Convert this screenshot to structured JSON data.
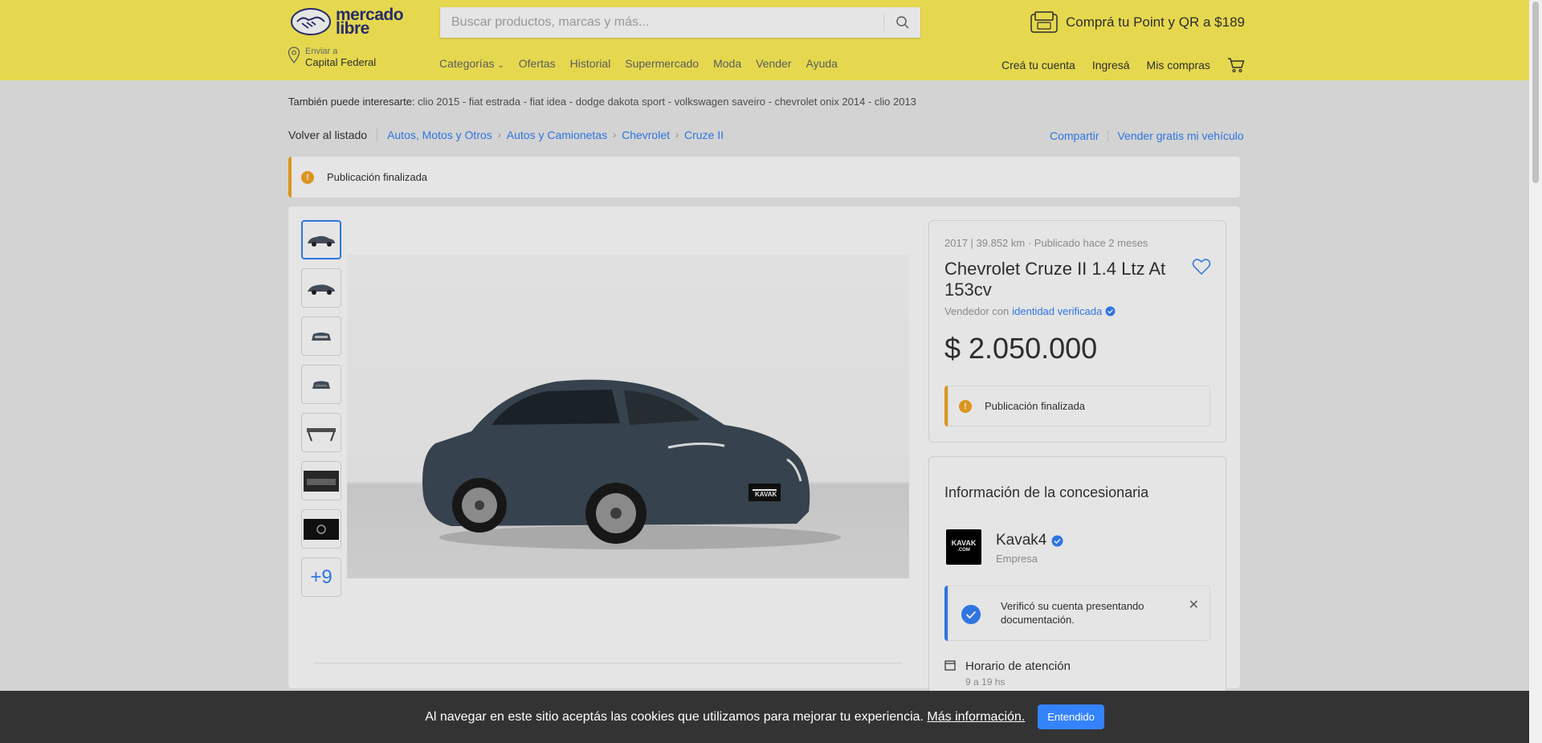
{
  "header": {
    "logo_text_line1": "mercado",
    "logo_text_line2": "libre",
    "search_placeholder": "Buscar productos, marcas y más...",
    "promo_text": "Comprá tu Point y QR a $189",
    "location_label": "Enviar a",
    "location_value": "Capital Federal",
    "nav": [
      "Categorías",
      "Ofertas",
      "Historial",
      "Supermercado",
      "Moda",
      "Vender",
      "Ayuda"
    ],
    "user_nav": [
      "Creá tu cuenta",
      "Ingresá",
      "Mis compras"
    ]
  },
  "suggestions": {
    "label": "También puede interesarte:",
    "items": "clio 2015 - fiat estrada - fiat idea - dodge dakota sport - volkswagen saveiro - chevrolet onix 2014 - clio 2013"
  },
  "breadcrumb": {
    "back": "Volver al listado",
    "items": [
      "Autos, Motos y Otros",
      "Autos y Camionetas",
      "Chevrolet",
      "Cruze II"
    ]
  },
  "actions": {
    "share": "Compartir",
    "sell": "Vender gratis mi vehículo"
  },
  "alert": {
    "text": "Publicación finalizada"
  },
  "gallery": {
    "more_count": "+9",
    "logo_text": "KAVAK"
  },
  "listing": {
    "meta": "2017 | 39.852 km · Publicado hace 2 meses",
    "title": "Chevrolet Cruze II 1.4 Ltz At 153cv",
    "seller_prefix": "Vendedor con",
    "seller_highlight": "identidad verificada",
    "price": "$ 2.050.000",
    "status": "Publicación finalizada"
  },
  "dealer": {
    "heading": "Información de la concesionaria",
    "logo_top": "KAVAK",
    "logo_bottom": ".COM",
    "name": "Kavak4",
    "type": "Empresa",
    "verified_text": "Verificó su cuenta presentando documentación.",
    "hours_label": "Horario de atención",
    "hours_value": "9 a 19 hs"
  },
  "cookie": {
    "text": "Al navegar en este sitio aceptás las cookies que utilizamos para mejorar tu experiencia.",
    "link": "Más información.",
    "button": "Entendido"
  },
  "colors": {
    "header_bg": "#fff159",
    "accent": "#3483fa",
    "warning": "#f5a623"
  }
}
